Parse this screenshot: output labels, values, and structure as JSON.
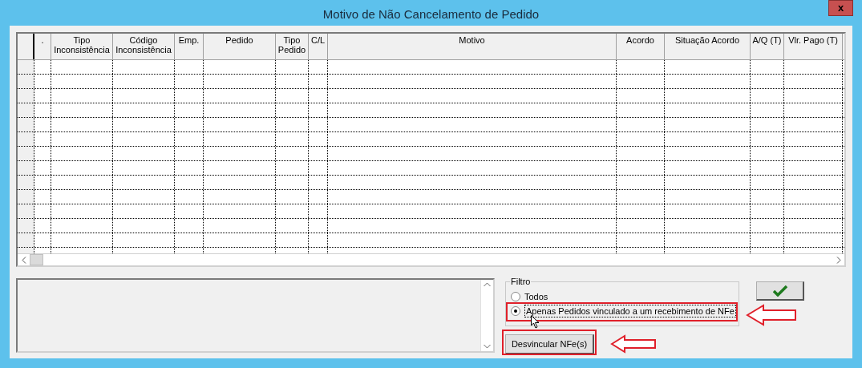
{
  "window": {
    "title": "Motivo de Não Cancelamento de Pedido",
    "close": "x"
  },
  "table": {
    "columns": [
      ".",
      "Tipo Inconsistência",
      "Código Inconsistência",
      "Emp.",
      "Pedido",
      "Tipo Pedido",
      "C/L",
      "Motivo",
      "Acordo",
      "Situação Acordo",
      "A/Q (T)",
      "Vlr. Pago (T)"
    ]
  },
  "filter": {
    "title": "Filtro",
    "options": [
      {
        "label": "Todos",
        "selected": false
      },
      {
        "label": "Apenas Pedidos vinculado a um recebimento de NFe",
        "selected": true
      }
    ]
  },
  "buttons": {
    "unlink": "Desvincular NFe(s)"
  }
}
